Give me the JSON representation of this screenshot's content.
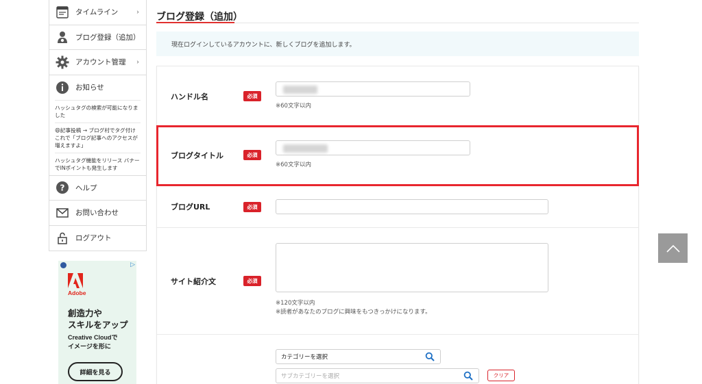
{
  "sidebar": {
    "items": [
      {
        "label": "タイムライン",
        "icon": "timeline-icon",
        "chevron": "›"
      },
      {
        "label": "ブログ登録（追加）",
        "icon": "user-add-icon"
      },
      {
        "label": "アカウント管理",
        "icon": "gear-icon",
        "chevron": "›"
      },
      {
        "label": "お知らせ",
        "icon": "info-icon"
      }
    ],
    "news": [
      "ハッシュタグの検索が可能になりました",
      "😄記事投稿 → ブログ村でタグ付け　これで「ブログ記事へのアクセスが増えますよ」",
      "ハッシュタグ機能をリリース バナーでINポイントも発生します"
    ],
    "bottom_items": [
      {
        "label": "ヘルプ",
        "icon": "help-icon"
      },
      {
        "label": "お問い合わせ",
        "icon": "mail-icon"
      },
      {
        "label": "ログアウト",
        "icon": "logout-icon"
      }
    ]
  },
  "ad": {
    "brand": "Adobe",
    "headline_1": "創造力や",
    "headline_2": "スキルをアップ",
    "sub_1": "Creative Cloudで",
    "sub_2": "イメージを形に",
    "button": "詳細を見る"
  },
  "page": {
    "title": "ブログ登録（追加）",
    "notice": "現在ログインしているアカウントに、新しくブログを追加します。"
  },
  "form": {
    "required_label": "必須",
    "handle": {
      "label": "ハンドル名",
      "hint": "※60文字以内"
    },
    "blog_title": {
      "label": "ブログタイトル",
      "hint": "※60文字以内"
    },
    "blog_url": {
      "label": "ブログURL"
    },
    "site_intro": {
      "label": "サイト紹介文",
      "hint_1": "※120文字以内",
      "hint_2": "※読者があなたのブログに興味をもつきっかけになります。"
    },
    "category": {
      "value": "カテゴリーを選択"
    },
    "subcategory": {
      "placeholder": "サブカテゴリーを選択"
    },
    "clear_label": "クリア"
  },
  "colors": {
    "accent": "#d9222a",
    "highlight": "#e8262e",
    "notice_bg": "#f1f9fb"
  }
}
